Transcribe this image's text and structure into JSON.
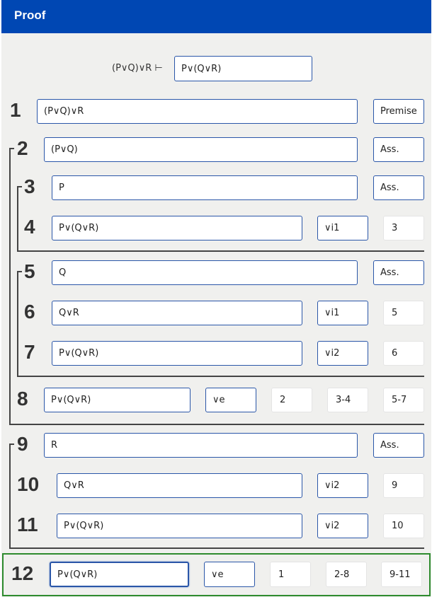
{
  "header": {
    "title": "Proof"
  },
  "goal": {
    "premise": "(P∨Q)∨R ⊢",
    "conclusion": "P∨(Q∨R)"
  },
  "lines": [
    {
      "num": "1",
      "formula": "(P∨Q)∨R",
      "rule": "Premise",
      "refs": []
    },
    {
      "num": "2",
      "formula": "(P∨Q)",
      "rule": "Ass.",
      "refs": []
    },
    {
      "num": "3",
      "formula": "P",
      "rule": "Ass.",
      "refs": []
    },
    {
      "num": "4",
      "formula": "P∨(Q∨R)",
      "rule": "∨i1",
      "refs": [
        "3"
      ]
    },
    {
      "num": "5",
      "formula": "Q",
      "rule": "Ass.",
      "refs": []
    },
    {
      "num": "6",
      "formula": "Q∨R",
      "rule": "∨i1",
      "refs": [
        "5"
      ]
    },
    {
      "num": "7",
      "formula": "P∨(Q∨R)",
      "rule": "∨i2",
      "refs": [
        "6"
      ]
    },
    {
      "num": "8",
      "formula": "P∨(Q∨R)",
      "rule": "∨e",
      "refs": [
        "2",
        "3-4",
        "5-7"
      ]
    },
    {
      "num": "9",
      "formula": "R",
      "rule": "Ass.",
      "refs": []
    },
    {
      "num": "10",
      "formula": "Q∨R",
      "rule": "∨i2",
      "refs": [
        "9"
      ]
    },
    {
      "num": "11",
      "formula": "P∨(Q∨R)",
      "rule": "∨i2",
      "refs": [
        "10"
      ]
    },
    {
      "num": "12",
      "formula": "P∨(Q∨R)",
      "rule": "∨e",
      "refs": [
        "1",
        "2-8",
        "9-11"
      ]
    }
  ]
}
